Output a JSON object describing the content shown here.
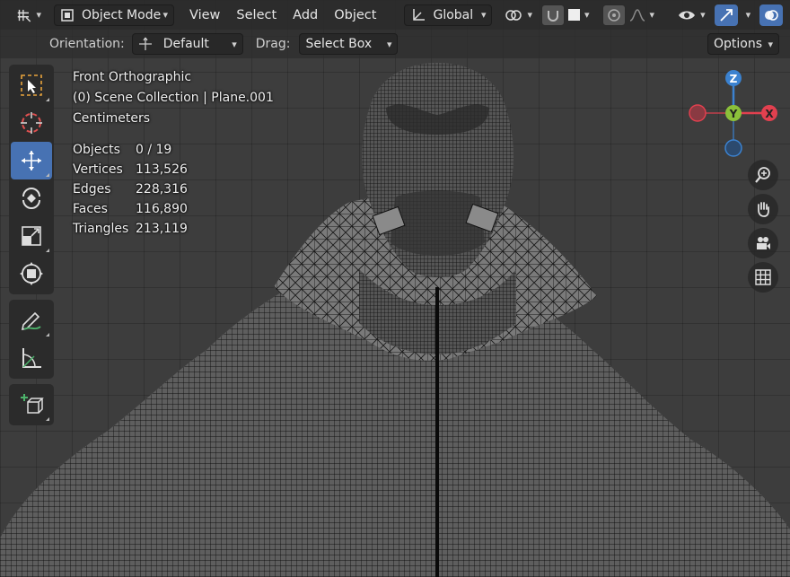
{
  "header": {
    "editor_type_icon": "viewport-grid-icon",
    "mode": "Object Mode",
    "menus": [
      "View",
      "Select",
      "Add",
      "Object"
    ],
    "transform_orientation": "Global",
    "options_label": "Options"
  },
  "subheader": {
    "orientation_label": "Orientation:",
    "orientation_value": "Default",
    "drag_label": "Drag:",
    "drag_value": "Select Box"
  },
  "overlay": {
    "view_name": "Front Orthographic",
    "collection": "(0) Scene Collection | Plane.001",
    "units": "Centimeters"
  },
  "stats": [
    {
      "label": "Objects",
      "value": "0 / 19"
    },
    {
      "label": "Vertices",
      "value": "113,526"
    },
    {
      "label": "Edges",
      "value": "228,316"
    },
    {
      "label": "Faces",
      "value": "116,890"
    },
    {
      "label": "Triangles",
      "value": "213,119"
    }
  ],
  "gizmo": {
    "z": "Z",
    "y": "Y",
    "x": "X"
  },
  "colors": {
    "x_axis": "#e2404f",
    "y_axis": "#8bc03a",
    "z_axis": "#3b82d0",
    "active_tool": "#4772b3"
  },
  "tools": [
    "select-box-icon",
    "cursor-icon",
    "move-icon",
    "rotate-icon",
    "scale-icon",
    "transform-icon",
    "annotate-icon",
    "measure-icon",
    "add-cube-icon"
  ]
}
